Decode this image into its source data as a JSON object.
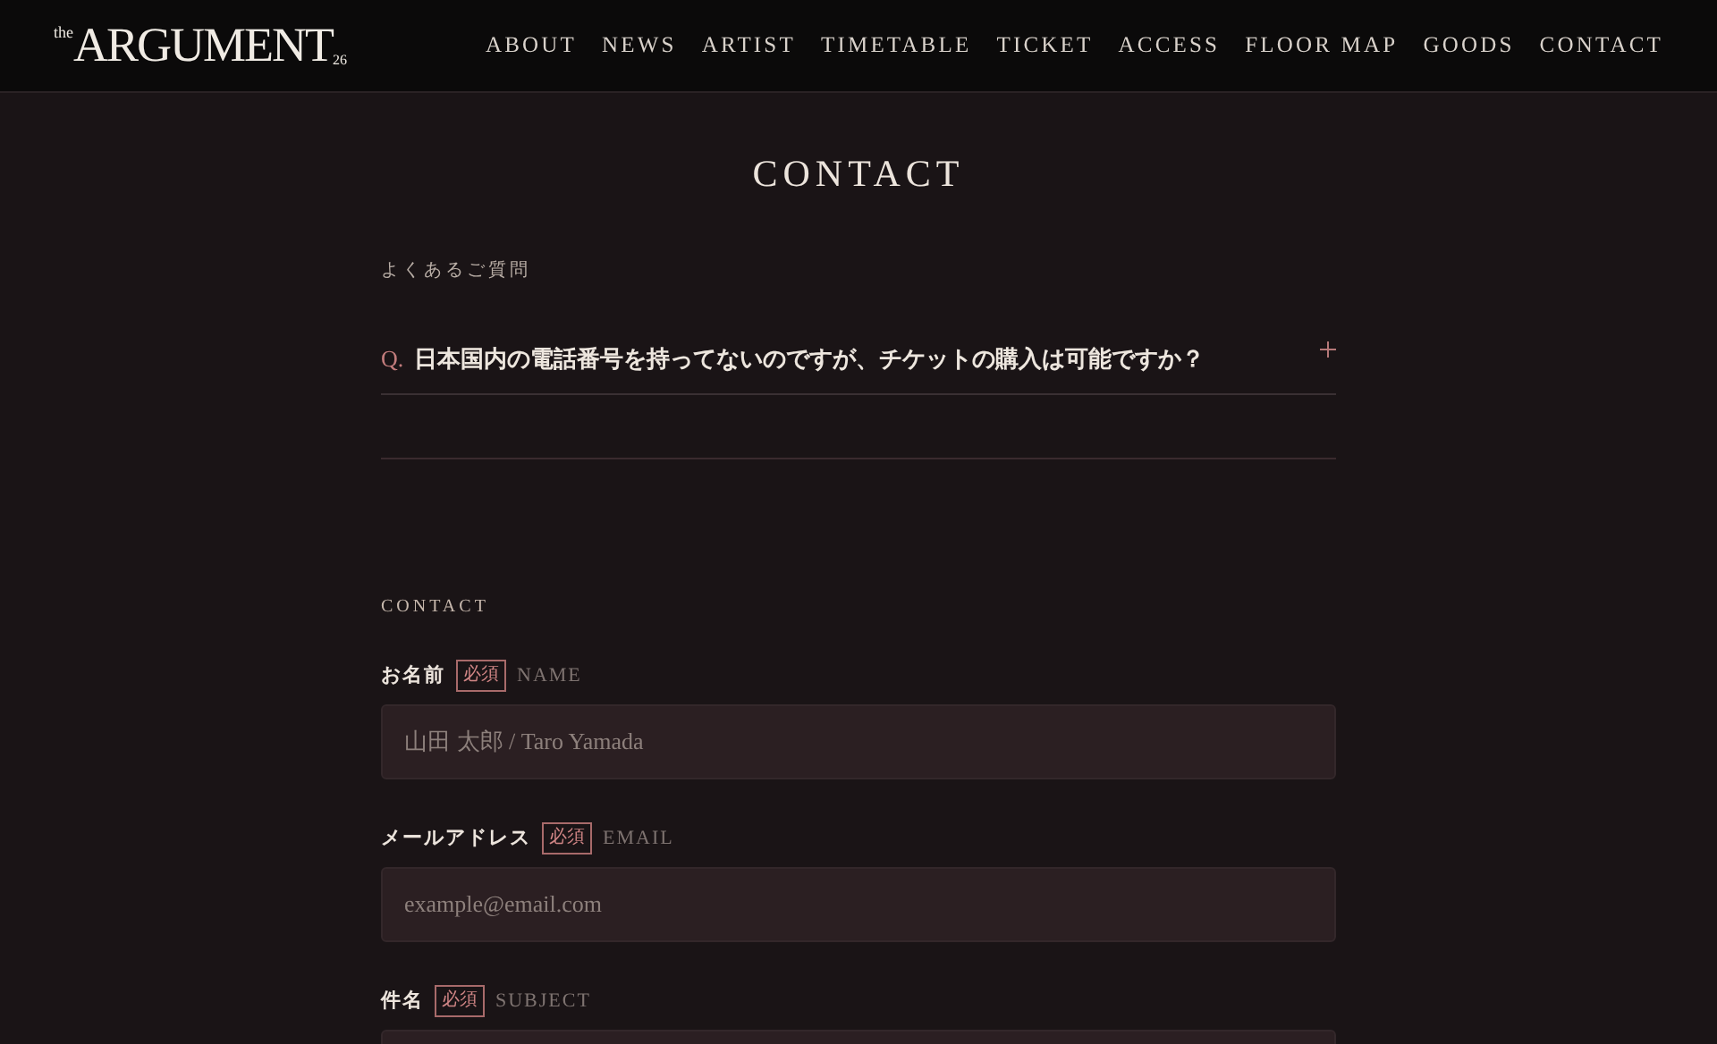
{
  "header": {
    "logo": {
      "prefix": "the",
      "name": "ARGUMENT",
      "suffix": "26"
    },
    "nav": [
      "ABOUT",
      "NEWS",
      "ARTIST",
      "TIMETABLE",
      "TICKET",
      "ACCESS",
      "FLOOR MAP",
      "GOODS",
      "CONTACT"
    ]
  },
  "page_title": "CONTACT",
  "faq": {
    "heading": "よくあるご質問",
    "items": [
      {
        "marker": "Q.",
        "question": "日本国内の電話番号を持ってないのですが、チケットの購入は可能ですか？",
        "expanded": false
      }
    ]
  },
  "contact": {
    "heading": "CONTACT",
    "fields": [
      {
        "label": "お名前",
        "required": true,
        "required_label": "必須",
        "sublabel": "NAME",
        "placeholder": "山田 太郎 / Taro Yamada"
      },
      {
        "label": "メールアドレス",
        "required": true,
        "required_label": "必須",
        "sublabel": "EMAIL",
        "placeholder": "example@email.com"
      },
      {
        "label": "件名",
        "required": true,
        "required_label": "必須",
        "sublabel": "SUBJECT"
      }
    ]
  }
}
